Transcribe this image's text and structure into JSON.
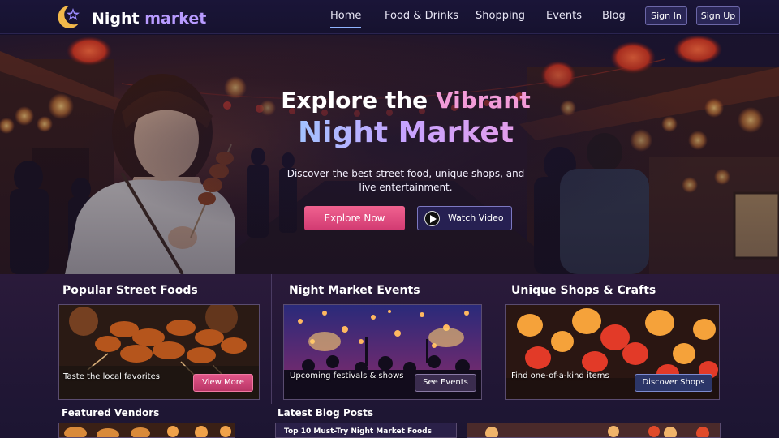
{
  "brand": {
    "name_part1": "Night",
    "name_part2": "market"
  },
  "nav": {
    "items": [
      {
        "label": "Home",
        "active": true
      },
      {
        "label": "Food & Drinks",
        "active": false
      },
      {
        "label": "Shopping",
        "active": false
      },
      {
        "label": "Events",
        "active": false
      },
      {
        "label": "Blog",
        "active": false
      }
    ],
    "sign_in": "Sign In",
    "sign_up": "Sign Up"
  },
  "hero": {
    "title_part1": "Explore the",
    "title_part2": "Vibrant",
    "title_line2": "Night Market",
    "subtitle": "Discover the best street food, unique shops, and live entertainment.",
    "explore_button": "Explore Now",
    "watch_button": "Watch Video"
  },
  "cards": [
    {
      "title": "Popular Street Foods",
      "caption": "Taste the local favorites",
      "button": "View More"
    },
    {
      "title": "Night  Market Events",
      "caption": "Upcoming festivals & shows",
      "button": "See Events"
    },
    {
      "title": "Unique Shops & Crafts",
      "caption": "Find one-of-a-kind items",
      "button": "Discover Shops"
    }
  ],
  "featured": {
    "title": "Featured Vendors"
  },
  "blog": {
    "title": "Latest Blog Posts",
    "first_post": "Top 10 Must-Try Night Market Foods"
  },
  "colors": {
    "accent_pink": "#e25689",
    "accent_purple": "#b89bff",
    "nav_bg": "#1a1538"
  }
}
